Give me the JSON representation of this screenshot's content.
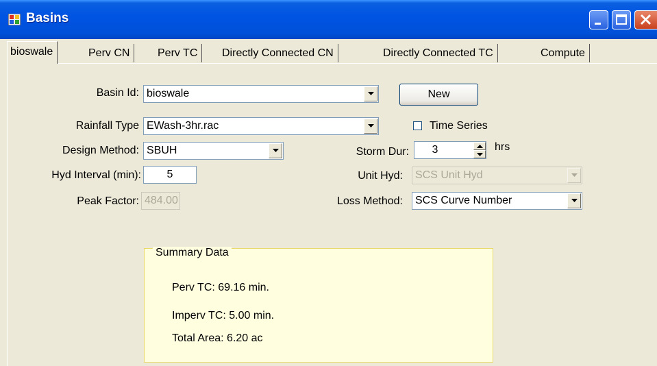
{
  "window": {
    "title": "Basins"
  },
  "tabs": [
    {
      "label": "bioswale",
      "active": true
    },
    {
      "label": "Perv CN"
    },
    {
      "label": "Perv TC"
    },
    {
      "label": "Directly Connected CN"
    },
    {
      "label": "Directly Connected TC"
    },
    {
      "label": "Compute"
    }
  ],
  "form": {
    "basin_id_label": "Basin Id:",
    "basin_id_value": "bioswale",
    "new_button": "New",
    "rainfall_type_label": "Rainfall Type",
    "rainfall_type_value": "EWash-3hr.rac",
    "time_series_label": "Time Series",
    "time_series_checked": false,
    "design_method_label": "Design Method:",
    "design_method_value": "SBUH",
    "storm_dur_label": "Storm Dur:",
    "storm_dur_value": "3",
    "storm_dur_unit": "hrs",
    "hyd_interval_label": "Hyd Interval (min):",
    "hyd_interval_value": "5",
    "unit_hyd_label": "Unit Hyd:",
    "unit_hyd_value": "SCS Unit Hyd",
    "peak_factor_label": "Peak Factor:",
    "peak_factor_value": "484.00",
    "loss_method_label": "Loss Method:",
    "loss_method_value": "SCS Curve Number"
  },
  "summary": {
    "title": "Summary Data",
    "perv_tc": "Perv TC: 69.16 min.",
    "imperv_tc": "Imperv TC: 5.00 min.",
    "total_area": "Total Area: 6.20 ac"
  }
}
